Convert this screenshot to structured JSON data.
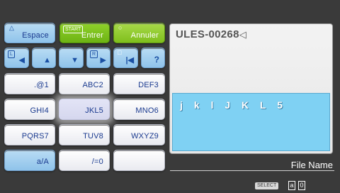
{
  "top_keys": {
    "espace": "Espace",
    "entrer": "Entrer",
    "entrer_tag": "START",
    "annuler": "Annuler"
  },
  "nav_keys": {
    "l_tag": "L",
    "r_tag": "R",
    "help": "?"
  },
  "grid_keys": [
    ".@1",
    "ABC2",
    "DEF3",
    "GHI4",
    "JKL5",
    "MNO6",
    "PQRS7",
    "TUV8",
    "WXYZ9",
    "a/A",
    "/=0",
    ""
  ],
  "panel": {
    "title": "ULES-00268",
    "entry": "j k l J K L 5"
  },
  "footer": {
    "file_name_label": "File Name",
    "select_label": "SELECT",
    "mode_1": "a",
    "mode_2": "0"
  }
}
